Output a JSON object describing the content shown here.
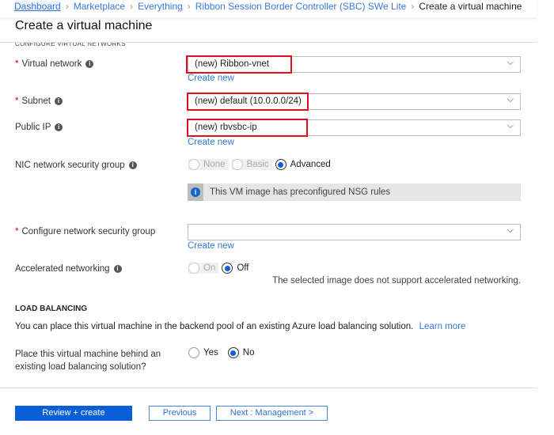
{
  "breadcrumb": [
    "Dashboard",
    "Marketplace",
    "Everything",
    "Ribbon Session Border Controller (SBC) SWe Lite",
    "Create a virtual machine"
  ],
  "title": "Create a virtual machine",
  "section_clipped": "CONFIGURE VIRTUAL NETWORKS",
  "fields": {
    "vnet": {
      "label": "Virtual network",
      "value": "(new) Ribbon-vnet",
      "create_new": "Create new"
    },
    "subnet": {
      "label": "Subnet",
      "value": "(new) default (10.0.0.0/24)"
    },
    "public_ip": {
      "label": "Public IP",
      "value": "(new) rbvsbc-ip",
      "create_new": "Create new"
    },
    "nic_nsg": {
      "label": "NIC network security group",
      "options": [
        "None",
        "Basic",
        "Advanced"
      ],
      "selected": "Advanced",
      "info": "This VM image has preconfigured NSG rules"
    },
    "config_nsg": {
      "label": "Configure network security group",
      "value": "",
      "create_new": "Create new"
    },
    "accel": {
      "label": "Accelerated networking",
      "options": [
        "On",
        "Off"
      ],
      "selected": "Off",
      "note": "The selected image does not support accelerated networking."
    }
  },
  "load_balancing": {
    "heading": "LOAD BALANCING",
    "description": "You can place this virtual machine in the backend pool of an existing Azure load balancing solution.",
    "learn_more": "Learn more",
    "question_line1": "Place this virtual machine behind an",
    "question_line2": "existing load balancing solution?",
    "options": [
      "Yes",
      "No"
    ],
    "selected": "No"
  },
  "footer": {
    "review": "Review + create",
    "previous": "Previous",
    "next": "Next : Management >"
  },
  "colors": {
    "accent": "#0a5fd8",
    "highlight": "#e0111b"
  }
}
